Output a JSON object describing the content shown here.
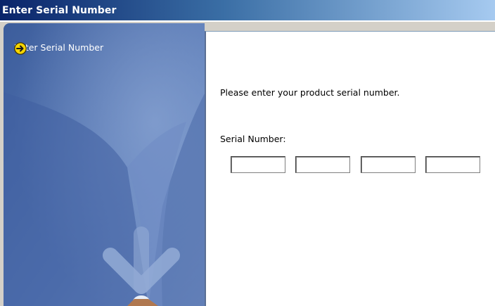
{
  "window": {
    "title": "Enter Serial Number"
  },
  "sidebar": {
    "items": [
      {
        "label": "Enter Serial Number",
        "icon": "arrow-right-circle-icon",
        "icon_color": "#f5d400"
      }
    ]
  },
  "main": {
    "prompt": "Please enter your product serial number.",
    "serial_label": "Serial Number:",
    "serial_fields": [
      {
        "value": ""
      },
      {
        "value": ""
      },
      {
        "value": ""
      },
      {
        "value": ""
      }
    ]
  },
  "colors": {
    "titlebar_start": "#0a246a",
    "titlebar_end": "#a6caf0",
    "sidebar": "#4567a3"
  }
}
